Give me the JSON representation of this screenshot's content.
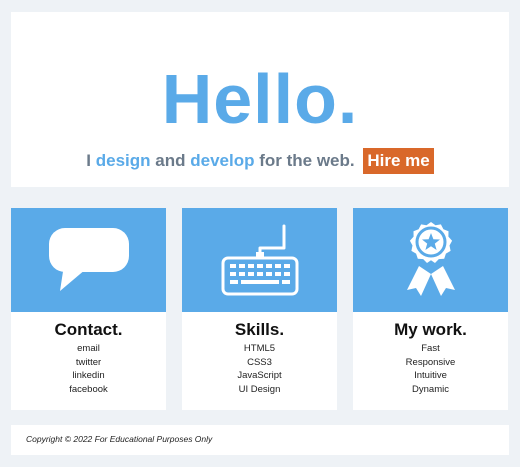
{
  "hero": {
    "title": "Hello.",
    "tagline_i": "I",
    "tagline_design": "design",
    "tagline_and": "and",
    "tagline_develop": "develop",
    "tagline_rest": "for the web.",
    "hire_label": "Hire me"
  },
  "colors": {
    "accent": "#5aaae8",
    "hire_button": "#d9682a",
    "text_muted": "#6b7a8a",
    "background": "#eef2f6"
  },
  "cards": [
    {
      "icon": "speech-bubble-icon",
      "title": "Contact.",
      "items": [
        "email",
        "twitter",
        "linkedin",
        "facebook"
      ]
    },
    {
      "icon": "keyboard-icon",
      "title": "Skills.",
      "items": [
        "HTML5",
        "CSS3",
        "JavaScript",
        "UI Design"
      ]
    },
    {
      "icon": "award-ribbon-icon",
      "title": "My work.",
      "items": [
        "Fast",
        "Responsive",
        "Intuitive",
        "Dynamic"
      ]
    }
  ],
  "footer": {
    "copyright": "Copyright © 2022 For Educational Purposes Only"
  }
}
